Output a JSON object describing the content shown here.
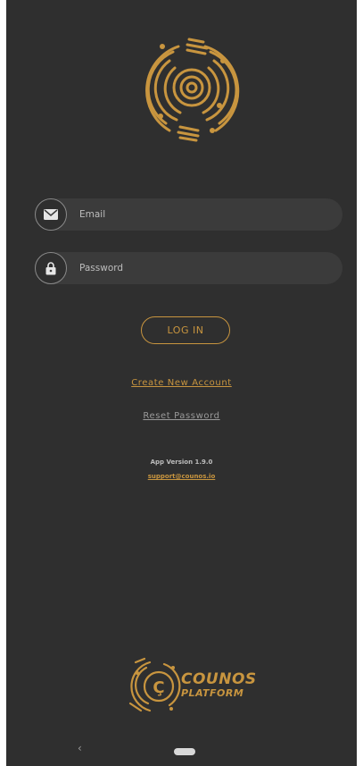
{
  "login": {
    "email_placeholder": "Email",
    "password_placeholder": "Password",
    "login_label": "LOG IN",
    "create_account_label": "Create New Account",
    "reset_password_label": "Reset Password"
  },
  "footer": {
    "app_version": "App Version 1.9.0",
    "support_email": "support@counos.io"
  },
  "brand": {
    "line1": "COUNOS",
    "line2": "PLATFORM",
    "accent_color": "#c8953f"
  },
  "icons": {
    "email": "envelope-icon",
    "password": "lock-icon",
    "nav_back": "chevron-left-icon",
    "nav_home": "home-pill-icon"
  },
  "nav": {
    "back_glyph": "‹"
  }
}
